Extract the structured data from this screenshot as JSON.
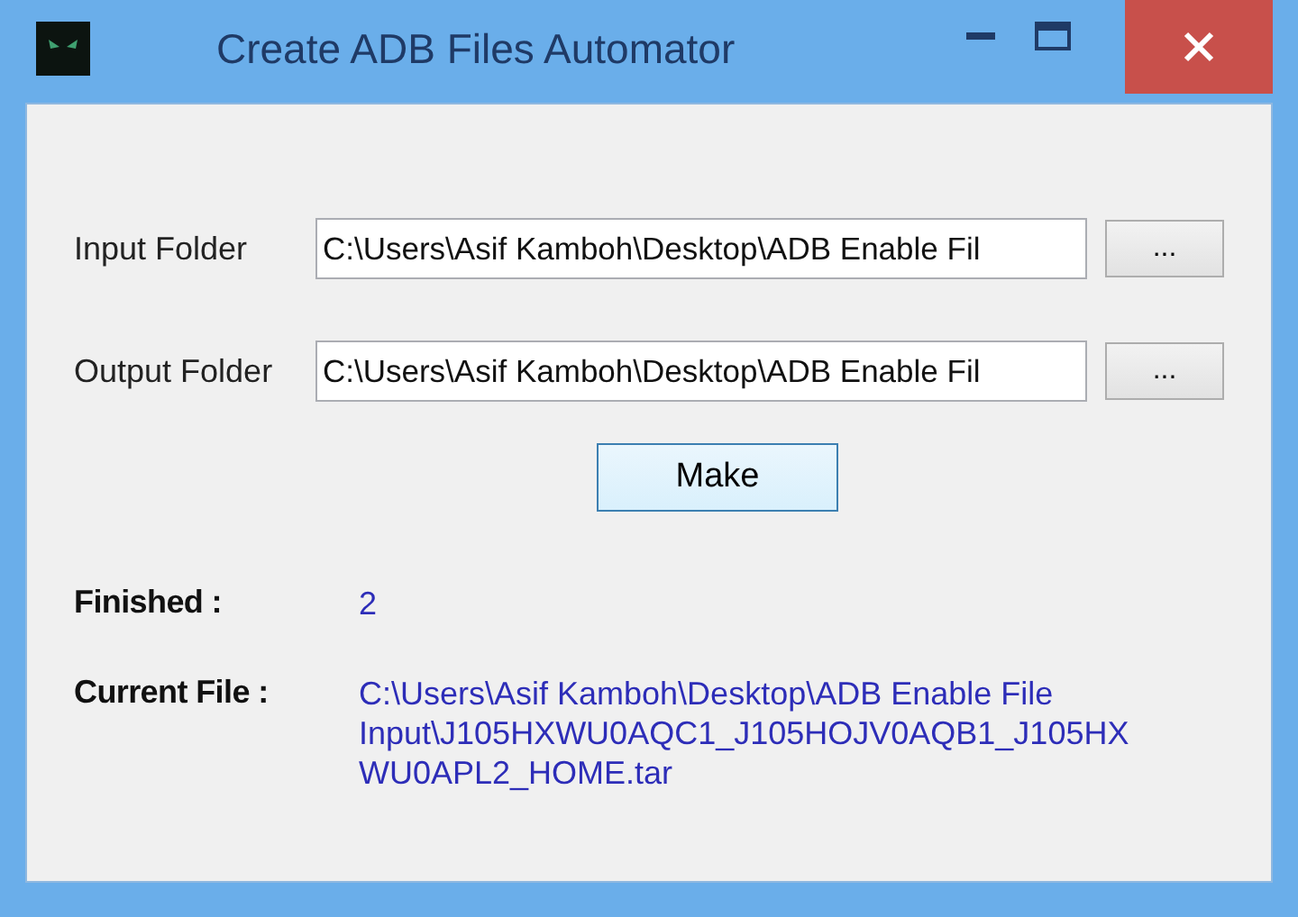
{
  "window": {
    "title": "Create ADB Files Automator"
  },
  "folders": [
    {
      "label": "Input Folder",
      "value": "C:\\Users\\Asif Kamboh\\Desktop\\ADB Enable Fil",
      "button": "..."
    },
    {
      "label": "Output Folder",
      "value": "C:\\Users\\Asif Kamboh\\Desktop\\ADB Enable Fil",
      "button": "..."
    }
  ],
  "make_button": "Make",
  "status": [
    {
      "label": "Finished :",
      "lines": [
        "2"
      ]
    },
    {
      "label": "Current File :",
      "lines": [
        "C:\\Users\\Asif Kamboh\\Desktop\\ADB Enable File",
        "Input\\J105HXWU0AQC1_J105HOJV0AQB1_J105HX",
        "WU0APL2_HOME.tar"
      ]
    }
  ]
}
